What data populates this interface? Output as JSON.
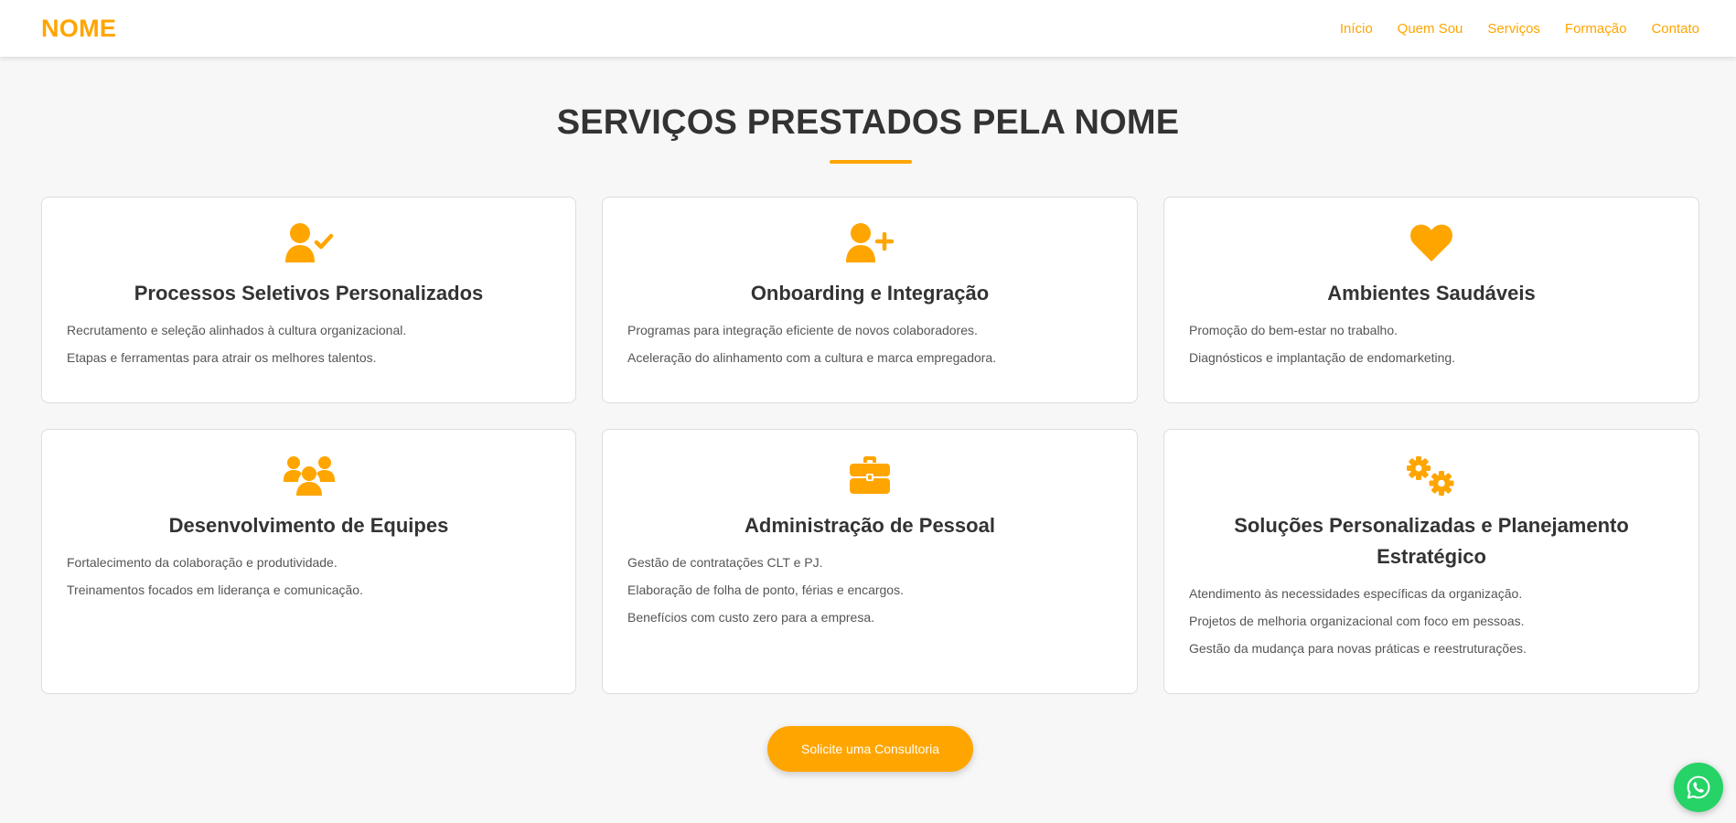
{
  "header": {
    "logo": "NOME",
    "nav": [
      "Início",
      "Quem Sou",
      "Serviços",
      "Formação",
      "Contato"
    ]
  },
  "section": {
    "title": "SERVIÇOS PRESTADOS PELA NOME"
  },
  "services": [
    {
      "icon": "user-check-icon",
      "title": "Processos Seletivos Personalizados",
      "items": [
        "Recrutamento e seleção alinhados à cultura organizacional.",
        "Etapas e ferramentas para atrair os melhores talentos."
      ]
    },
    {
      "icon": "user-plus-icon",
      "title": "Onboarding e Integração",
      "items": [
        "Programas para integração eficiente de novos colaboradores.",
        "Aceleração do alinhamento com a cultura e marca empregadora."
      ]
    },
    {
      "icon": "heart-icon",
      "title": "Ambientes Saudáveis",
      "items": [
        "Promoção do bem-estar no trabalho.",
        "Diagnósticos e implantação de endomarketing."
      ]
    },
    {
      "icon": "users-icon",
      "title": "Desenvolvimento de Equipes",
      "items": [
        "Fortalecimento da colaboração e produtividade.",
        "Treinamentos focados em liderança e comunicação."
      ]
    },
    {
      "icon": "briefcase-icon",
      "title": "Administração de Pessoal",
      "items": [
        "Gestão de contratações CLT e PJ.",
        "Elaboração de folha de ponto, férias e encargos.",
        "Benefícios com custo zero para a empresa."
      ]
    },
    {
      "icon": "cogs-icon",
      "title": "Soluções Personalizadas e Planejamento Estratégico",
      "items": [
        "Atendimento às necessidades específicas da organização.",
        "Projetos de melhoria organizacional com foco em pessoas.",
        "Gestão da mudança para novas práticas e reestruturações."
      ]
    }
  ],
  "cta": {
    "label": "Solicite uma Consultoria"
  },
  "floating": {
    "icon": "whatsapp-icon"
  },
  "colors": {
    "accent": "#ffa500",
    "whatsapp": "#25d366",
    "background": "#f7f7f7"
  }
}
